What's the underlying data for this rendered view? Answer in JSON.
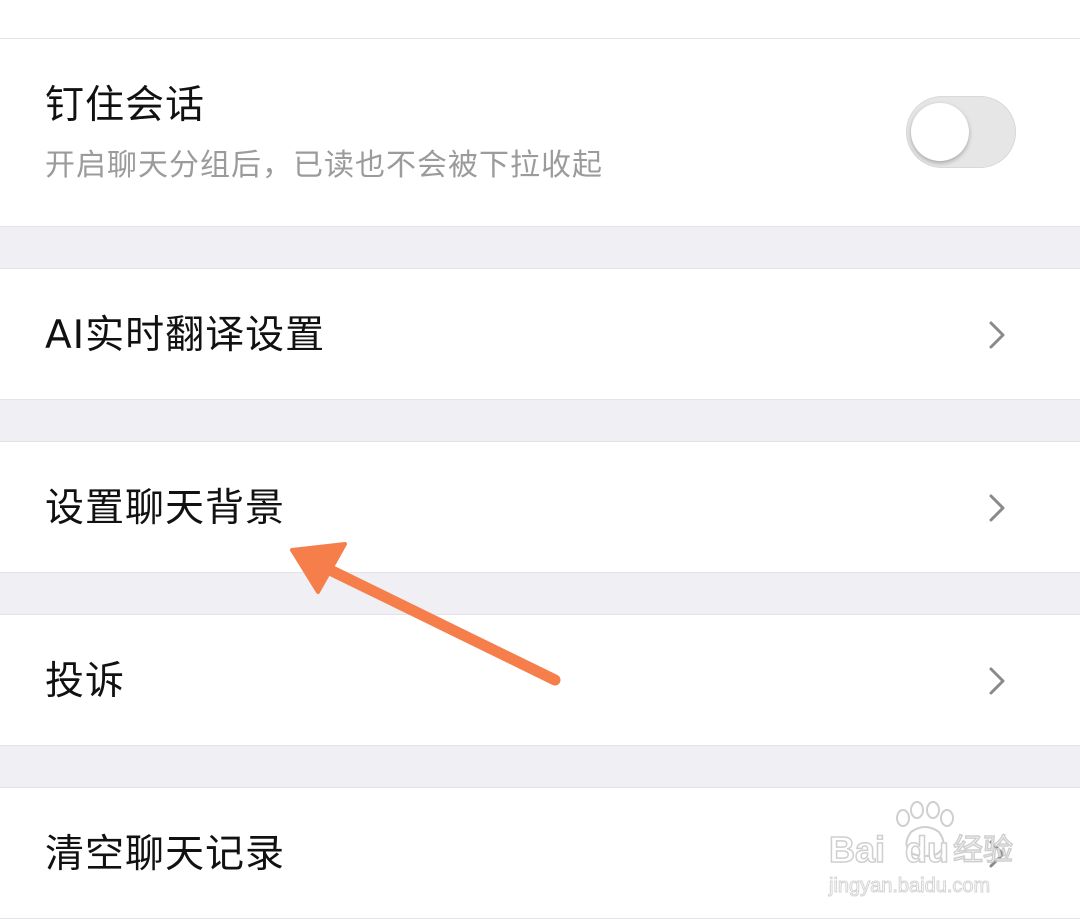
{
  "pin_chat": {
    "title": "钉住会话",
    "subtitle": "开启聊天分组后，已读也不会被下拉收起",
    "toggle_on": false
  },
  "menu": {
    "translate": "AI实时翻译设置",
    "background": "设置聊天背景",
    "complain": "投诉",
    "clear_history": "清空聊天记录"
  },
  "watermark": {
    "brand": "Bai",
    "brand2": "du",
    "brand_cn": "经验",
    "url": "jingyan.baidu.com"
  },
  "colors": {
    "arrow": "#F57E4B",
    "page_bg": "#EFEFF4",
    "subtitle": "#9B9B9B"
  }
}
